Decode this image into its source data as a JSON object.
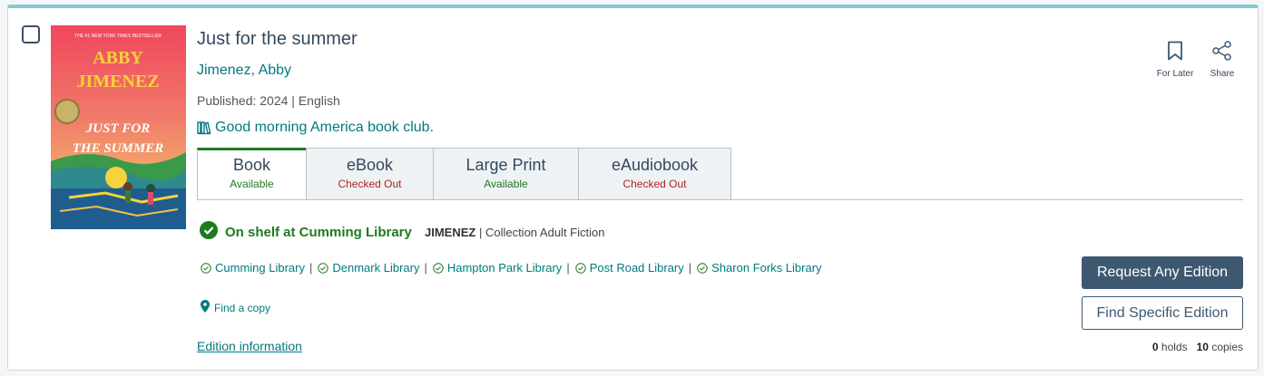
{
  "book": {
    "title": "Just for the summer",
    "author": "Jimenez, Abby",
    "published": "Published: 2024 | English",
    "series": "Good morning America book club."
  },
  "cover": {
    "tagline": "THE #1 NEW YORK TIMES BESTSELLER",
    "author_line1": "ABBY",
    "author_line2": "JIMENEZ",
    "title_line1": "JUST FOR",
    "title_line2": "THE SUMMER"
  },
  "formats": [
    {
      "label": "Book",
      "status": "Available",
      "state": "available"
    },
    {
      "label": "eBook",
      "status": "Checked Out",
      "state": "out"
    },
    {
      "label": "Large Print",
      "status": "Available",
      "state": "available"
    },
    {
      "label": "eAudiobook",
      "status": "Checked Out",
      "state": "out"
    }
  ],
  "availability": {
    "on_shelf": "On shelf at Cumming Library",
    "call_number": "JIMENEZ",
    "collection": " | Collection Adult Fiction"
  },
  "libraries": [
    "Cumming Library",
    "Denmark Library",
    "Hampton Park Library",
    "Post Road Library",
    "Sharon Forks Library"
  ],
  "separator": "|",
  "links": {
    "find_copy": "Find a copy",
    "edition_info": "Edition information"
  },
  "actions": {
    "for_later": "For Later",
    "share": "Share",
    "request": "Request Any Edition",
    "find_specific": "Find Specific Edition"
  },
  "counts": {
    "holds": "0",
    "holds_label": "holds",
    "copies": "10",
    "copies_label": "copies"
  },
  "colors": {
    "accent_teal": "#007a80",
    "available_green": "#1f7a1f",
    "checked_out_red": "#b22222",
    "button_navy": "#3e5871",
    "card_top_border": "#7fcbd3"
  },
  "icons": [
    "checkbox-icon",
    "library-books-icon",
    "check-circle-icon",
    "check-circle-outline-icon",
    "map-pin-icon",
    "bookmark-icon",
    "share-icon"
  ]
}
